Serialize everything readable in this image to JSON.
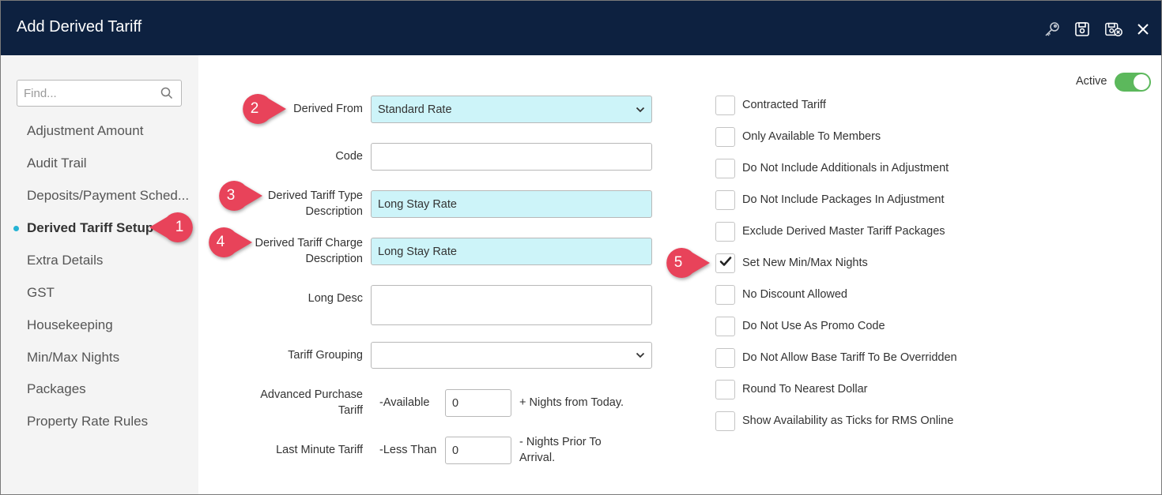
{
  "window": {
    "title": "Add Derived Tariff",
    "icons": [
      "key-icon",
      "save-icon",
      "save-and-close-icon",
      "close-icon"
    ]
  },
  "sidebar": {
    "search_placeholder": "Find...",
    "items": [
      {
        "label": "Adjustment Amount"
      },
      {
        "label": "Audit Trail"
      },
      {
        "label": "Deposits/Payment Sched..."
      },
      {
        "label": "Derived Tariff Setup",
        "active": true
      },
      {
        "label": "Extra Details"
      },
      {
        "label": "GST"
      },
      {
        "label": "Housekeeping"
      },
      {
        "label": "Min/Max Nights"
      },
      {
        "label": "Packages"
      },
      {
        "label": "Property Rate Rules"
      }
    ]
  },
  "form": {
    "derived_from": {
      "label": "Derived From",
      "value": "Standard Rate"
    },
    "code": {
      "label": "Code",
      "value": ""
    },
    "type_desc": {
      "label_line1": "Derived Tariff Type",
      "label_line2": "Description",
      "value": "Long Stay Rate"
    },
    "charge_desc": {
      "label_line1": "Derived Tariff Charge",
      "label_line2": "Description",
      "value": "Long Stay Rate"
    },
    "long_desc": {
      "label": "Long Desc",
      "value": ""
    },
    "tariff_grouping": {
      "label": "Tariff Grouping",
      "value": ""
    },
    "advanced_purchase": {
      "label_line1": "Advanced Purchase",
      "label_line2": "Tariff",
      "prefix": "-Available",
      "value": "0",
      "suffix": "+ Nights from Today."
    },
    "last_minute": {
      "label": "Last Minute Tariff",
      "prefix": "-Less Than",
      "value": "0",
      "suffix_line1": "- Nights Prior To",
      "suffix_line2": "Arrival."
    }
  },
  "options": {
    "active_label": "Active",
    "active": true,
    "checkboxes": [
      {
        "label": "Contracted Tariff",
        "checked": false
      },
      {
        "label": "Only Available To Members",
        "checked": false
      },
      {
        "label": "Do Not Include Additionals in Adjustment",
        "checked": false
      },
      {
        "label": "Do Not Include Packages In Adjustment",
        "checked": false
      },
      {
        "label": "Exclude Derived Master Tariff Packages",
        "checked": false
      },
      {
        "label": "Set New Min/Max Nights",
        "checked": true
      },
      {
        "label": "No Discount Allowed",
        "checked": false
      },
      {
        "label": "Do Not Use As Promo Code",
        "checked": false
      },
      {
        "label": "Do Not Allow Base Tariff To Be Overridden",
        "checked": false
      },
      {
        "label": "Round To Nearest Dollar",
        "checked": false
      },
      {
        "label": "Show Availability as Ticks for RMS Online",
        "checked": false
      }
    ]
  },
  "callouts": [
    "1",
    "2",
    "3",
    "4",
    "5"
  ],
  "colors": {
    "titlebar": "#0d2140",
    "highlight_field": "#cdf4f9",
    "callout": "#e8435a",
    "active_dot": "#25b3d4",
    "toggle_on": "#5cb85c"
  }
}
